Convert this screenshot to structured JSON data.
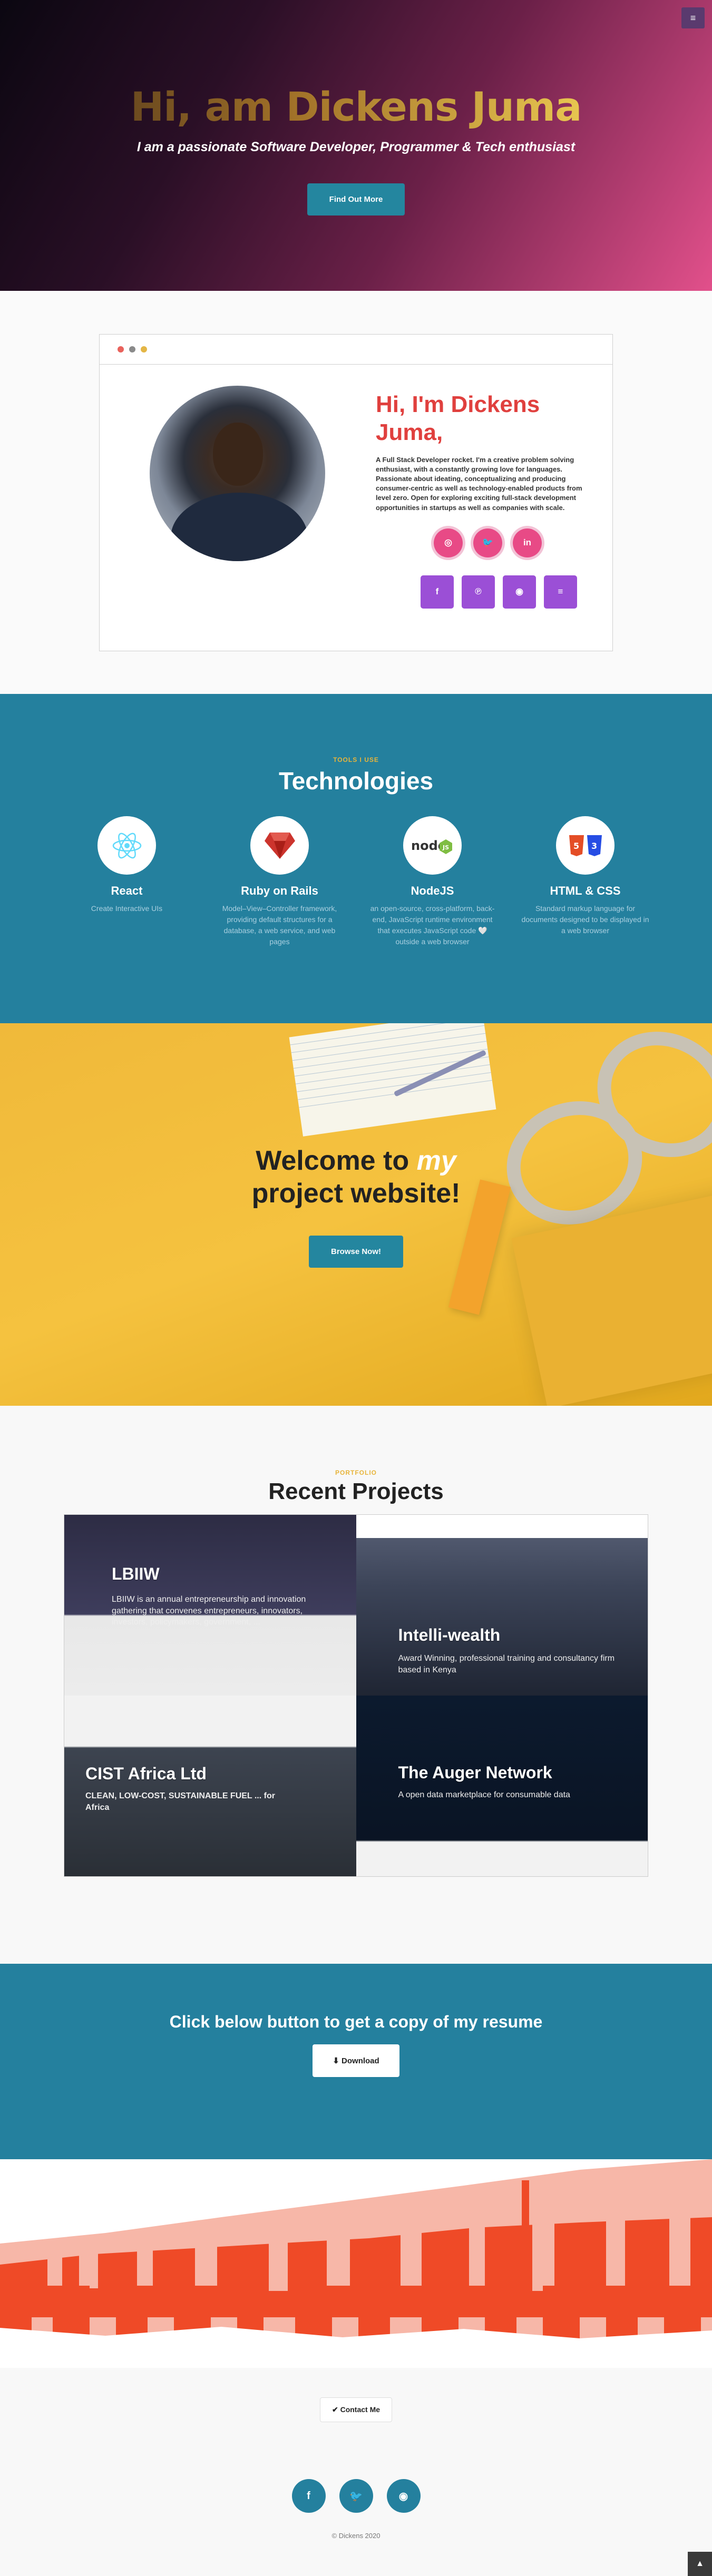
{
  "hero": {
    "menu_icon": "≡",
    "title": "Hi, am Dickens Juma",
    "tagline": "I am a passionate Software Developer, Programmer & Tech enthusiast",
    "cta": "Find Out More"
  },
  "about": {
    "heading": "Hi, I'm Dickens Juma,",
    "bio": "A Full Stack Developer rocket. I'm a creative problem solving enthusiast, with a constantly growing love for languages. Passionate about ideating, conceptualizing and producing consumer-centric as well as technology-enabled products from level zero. Open for exploring exciting full-stack development opportunities in startups as well as companies with scale.",
    "circle_icons": [
      "instagram-icon",
      "twitter-icon",
      "linkedin-icon"
    ],
    "square_icons": [
      "facebook-icon",
      "pinterest-icon",
      "github-icon",
      "stackoverflow-icon"
    ],
    "window_dots": [
      "#e9625c",
      "#8a8a8a",
      "#e4b646"
    ]
  },
  "technologies": {
    "kicker": "TOOLS I USE",
    "title": "Technologies",
    "items": [
      {
        "name": "React",
        "desc": "Create Interactive UIs",
        "icon": "react-icon"
      },
      {
        "name": "Ruby on Rails",
        "desc": "Model–View–Controller framework, providing default structures for a database, a web service, and web pages",
        "icon": "ruby-icon"
      },
      {
        "name": "NodeJS",
        "desc": "an open-source, cross-platform, back-end, JavaScript runtime environment that executes JavaScript code 🤍 outside a web browser",
        "icon": "nodejs-icon"
      },
      {
        "name": "HTML & CSS",
        "desc": "Standard markup language for documents designed to be displayed in a web browser",
        "icon": "html-css-icon"
      }
    ]
  },
  "welcome": {
    "line1": "Welcome to ",
    "emphasis": "my",
    "line2": "project website!",
    "cta": "Browse Now!"
  },
  "projects": {
    "kicker": "PORTFOLIO",
    "title": "Recent Projects",
    "items": [
      {
        "title": "LBIIW",
        "subtitle": "LBIIW is an annual entrepreneurship and innovation gathering that convenes entrepreneurs, innovators, investors, policymakers, government, ..."
      },
      {
        "title": "Intelli-wealth",
        "subtitle": "Award Winning, professional training and consultancy firm based in Kenya"
      },
      {
        "title": "CIST Africa Ltd",
        "subtitle": "CLEAN, LOW-COST, SUSTAINABLE FUEL ... for Africa"
      },
      {
        "title": "The Auger Network",
        "subtitle": "A open data marketplace for consumable data"
      }
    ]
  },
  "resume": {
    "title": "Click below button to get a copy of my resume",
    "cta": "Download"
  },
  "footer": {
    "contact": "Contact Me",
    "social_icons": [
      "facebook-icon",
      "twitter-icon",
      "github-icon"
    ],
    "copyright": "© Dickens 2020",
    "to_top": "▲"
  }
}
